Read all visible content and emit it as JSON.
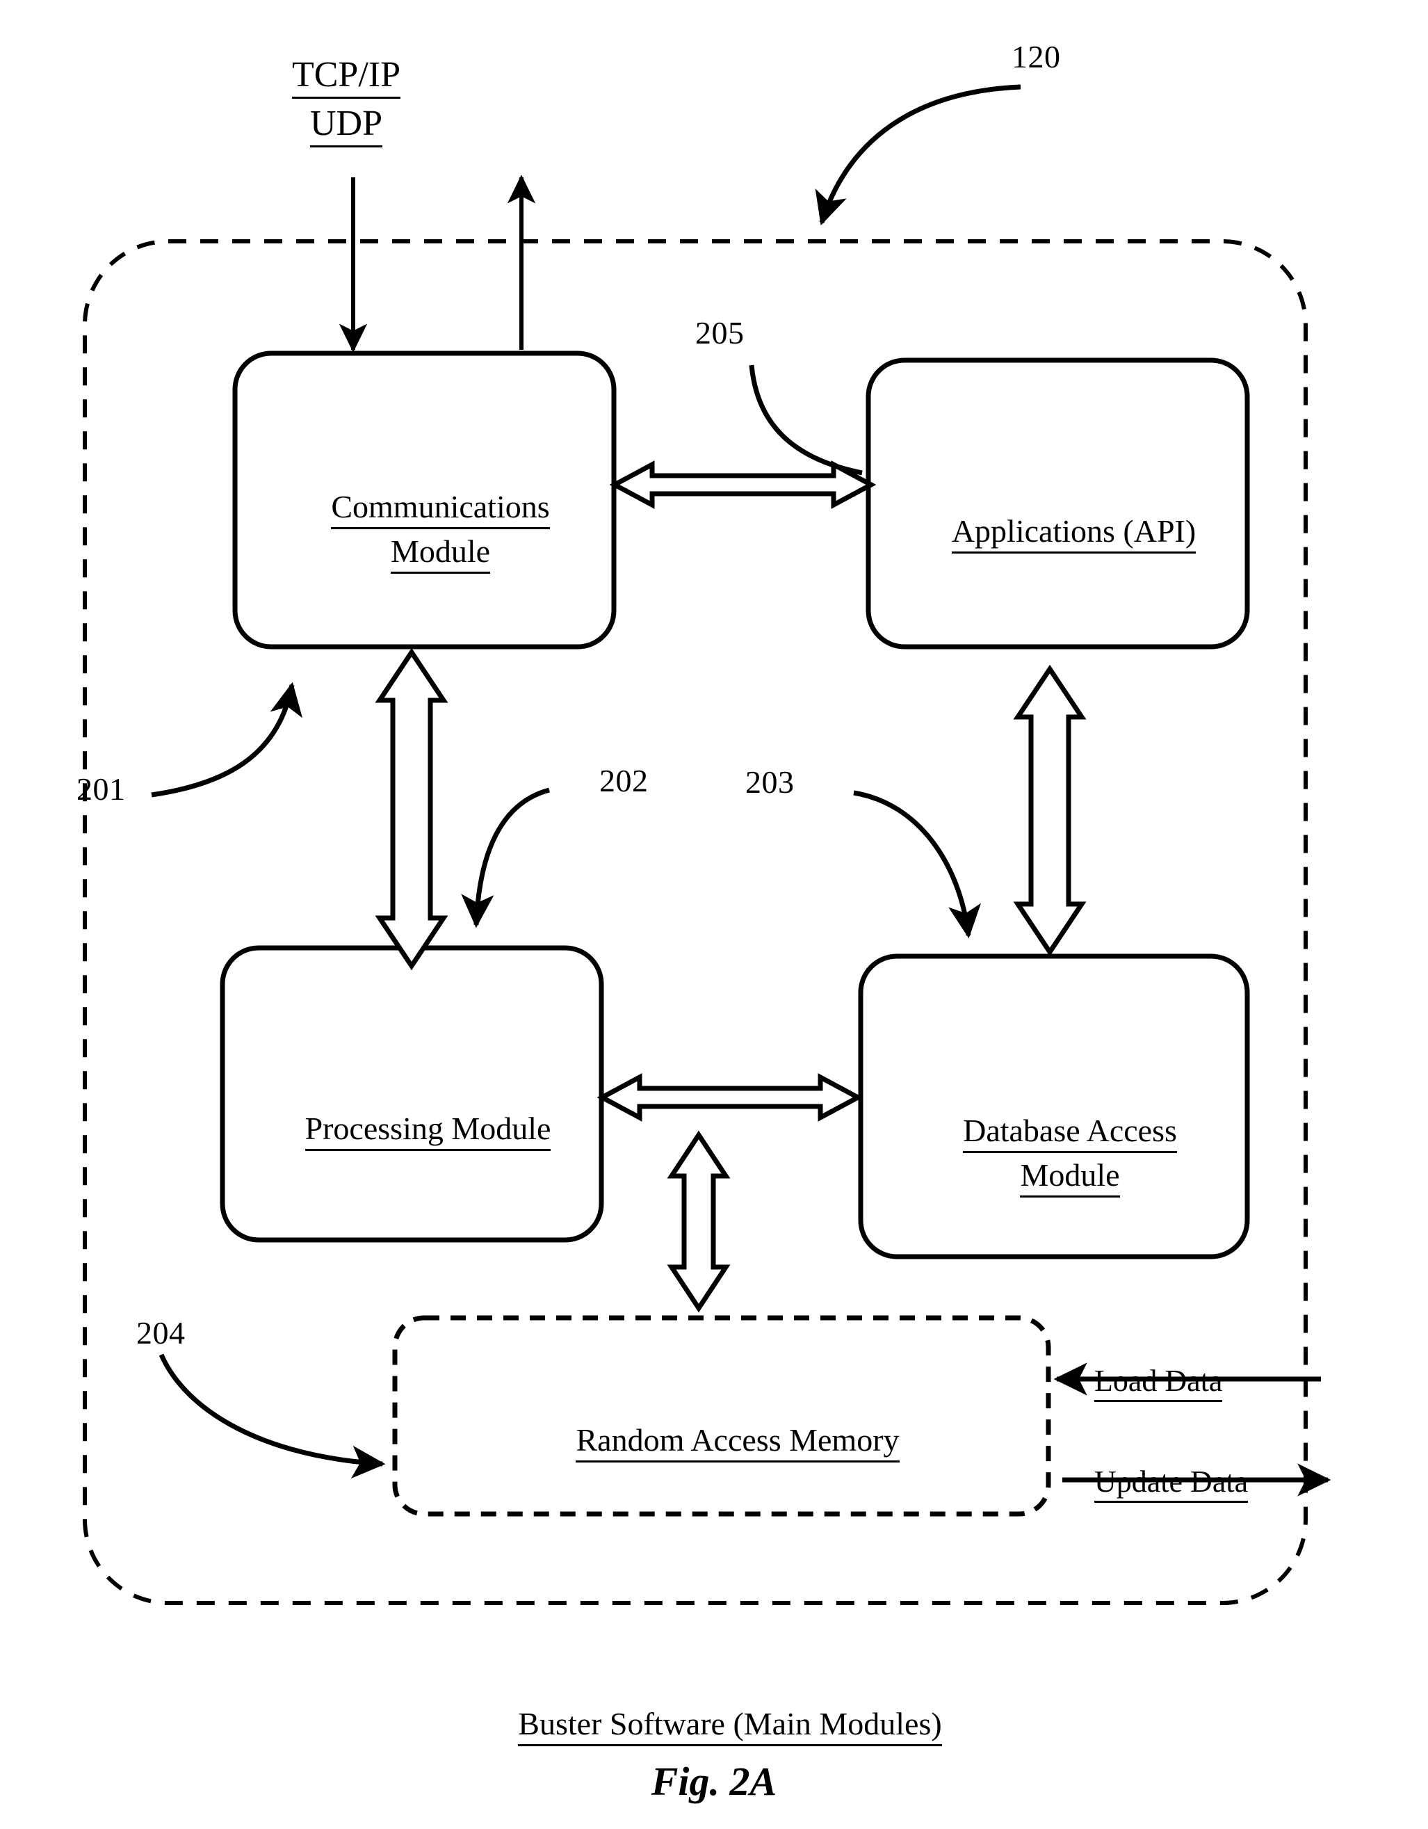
{
  "figure": {
    "id_label": "120",
    "caption": "Buster Software (Main Modules)",
    "fig_number": "Fig. 2A",
    "outer_boundary_style": "dashed-rounded-rectangle"
  },
  "network_labels": {
    "protocol_line_1": "TCP/IP",
    "protocol_line_2": "UDP"
  },
  "modules": {
    "communications": {
      "ref": "201",
      "line_1": "Communications",
      "line_2": "Module",
      "border": "solid"
    },
    "applications": {
      "ref": "205",
      "line_1": "Applications (API)",
      "line_2": "",
      "border": "solid"
    },
    "processing": {
      "ref": "202",
      "line_1": "Processing Module",
      "line_2": "",
      "border": "solid"
    },
    "database_access": {
      "ref": "203",
      "line_1": "Database Access",
      "line_2": "Module",
      "border": "solid"
    },
    "memory": {
      "ref": "204",
      "line_1": "Random Access Memory",
      "line_2": "",
      "border": "dashed"
    }
  },
  "data_flows": {
    "load": "Load Data",
    "update": "Update Data"
  },
  "colors": {
    "ink": "#000000",
    "paper": "#ffffff"
  }
}
